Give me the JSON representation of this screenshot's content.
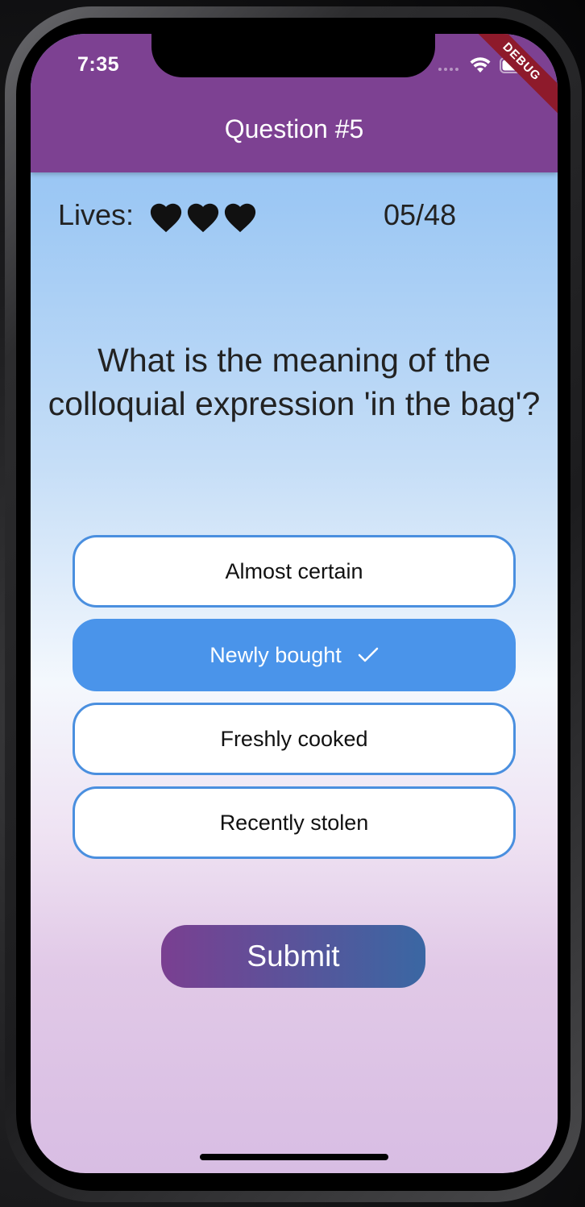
{
  "status_bar": {
    "time": "7:35",
    "debug_banner": "DEBUG"
  },
  "app_bar": {
    "title": "Question #5"
  },
  "stats": {
    "lives_label": "Lives:",
    "lives_count": 3,
    "heart_icon": "heart-icon",
    "progress": "05/48"
  },
  "question": {
    "text": "What is the meaning of the colloquial expression 'in the bag'?"
  },
  "answers": [
    {
      "label": "Almost certain",
      "selected": false
    },
    {
      "label": "Newly bought",
      "selected": true
    },
    {
      "label": "Freshly cooked",
      "selected": false
    },
    {
      "label": "Recently stolen",
      "selected": false
    }
  ],
  "submit": {
    "label": "Submit"
  },
  "colors": {
    "app_bar": "#7d4192",
    "selected_answer": "#4a94ea",
    "answer_border": "#4a8fdf",
    "submit_gradient_start": "#7a3f91",
    "submit_gradient_end": "#3a67a3",
    "debug_ribbon": "#8e1a2b"
  }
}
